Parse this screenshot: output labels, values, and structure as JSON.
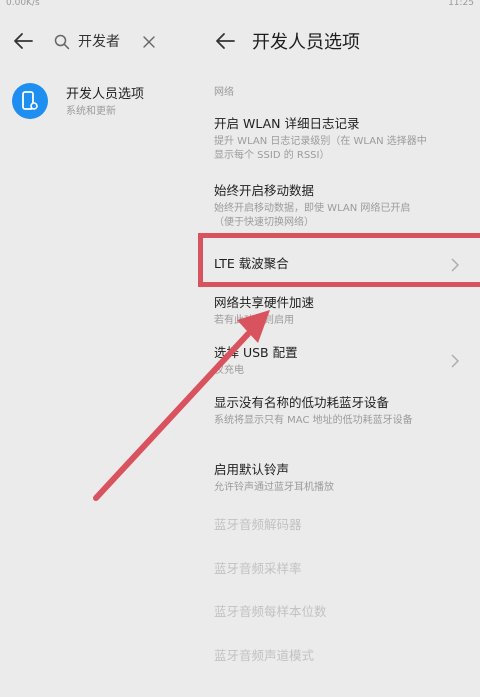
{
  "status": {
    "net_speed": "0.00K/s",
    "time": "11:25"
  },
  "left": {
    "search_query": "开发者",
    "result": {
      "title": "开发人员选项",
      "subtitle": "系统和更新"
    }
  },
  "right": {
    "title": "开发人员选项",
    "section": "网络",
    "items": [
      {
        "title": "开启 WLAN 详细日志记录",
        "subtitle": "提升 WLAN 日志记录级别（在 WLAN 选择器中显示每个 SSID 的 RSSI）"
      },
      {
        "title": "始终开启移动数据",
        "subtitle": "始终开启移动数据，即使 WLAN 网络已开启（便于快速切换网络）"
      },
      {
        "title": "LTE 载波聚合",
        "subtitle": ""
      },
      {
        "title": "网络共享硬件加速",
        "subtitle": "若有此功能则启用"
      },
      {
        "title": "选择 USB 配置",
        "subtitle": "仅充电"
      },
      {
        "title": "显示没有名称的低功耗蓝牙设备",
        "subtitle": "系统将显示只有 MAC 地址的低功耗蓝牙设备"
      },
      {
        "title": "启用默认铃声",
        "subtitle": "允许铃声通过蓝牙耳机播放"
      },
      {
        "title": "蓝牙音频解码器",
        "subtitle": ""
      },
      {
        "title": "蓝牙音频采样率",
        "subtitle": ""
      },
      {
        "title": "蓝牙音频每样本位数",
        "subtitle": ""
      },
      {
        "title": "蓝牙音频声道模式",
        "subtitle": ""
      }
    ]
  },
  "colors": {
    "accent": "#1f8ef1",
    "highlight": "#d9535e",
    "background": "#ebebeb"
  }
}
